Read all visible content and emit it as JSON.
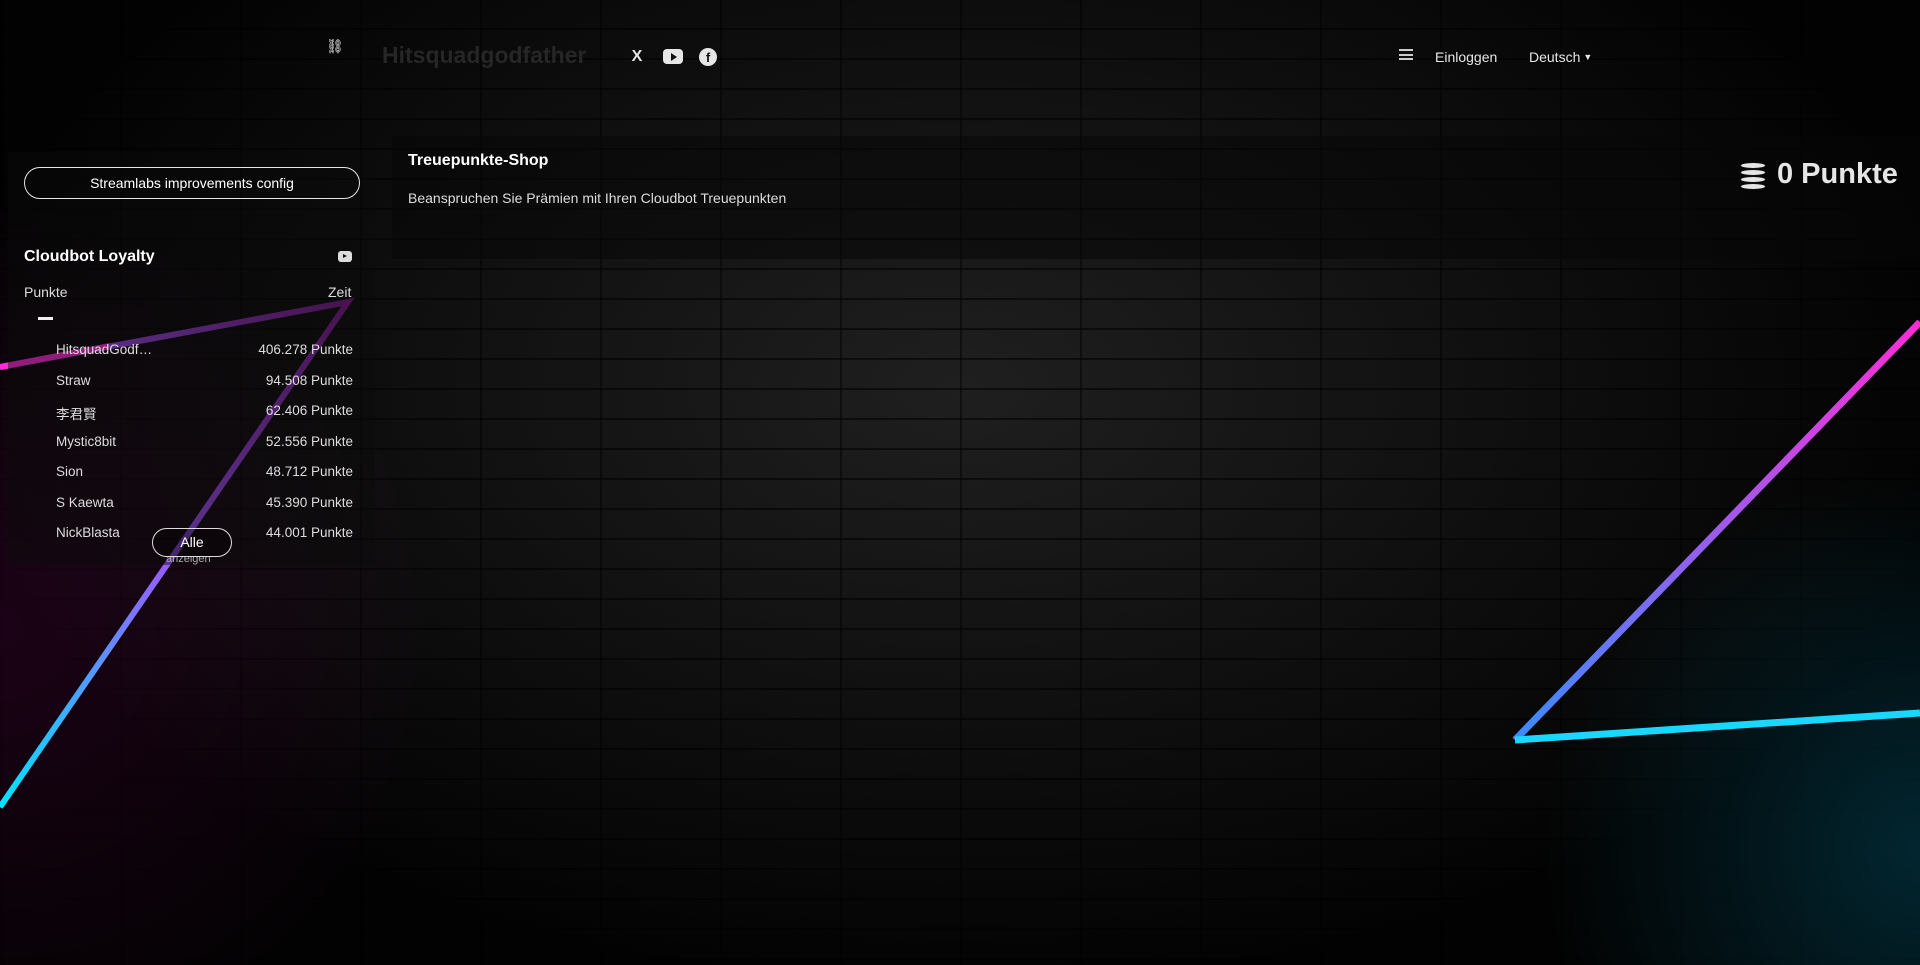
{
  "header": {
    "brand": "Hitsquadgodfather",
    "social": [
      {
        "name": "x-icon",
        "glyph": "X"
      },
      {
        "name": "youtube-icon",
        "glyph": ""
      },
      {
        "name": "facebook-icon",
        "glyph": "f"
      }
    ],
    "login_label": "Einloggen",
    "language_label": "Deutsch"
  },
  "sidebar": {
    "config_button_label": "Streamlabs improvements config",
    "loyalty_title": "Cloudbot Loyalty",
    "tabs": {
      "points": "Punkte",
      "time": "Zeit"
    },
    "ranking": [
      {
        "name": "HitsquadGodfather",
        "value": "406.278 Punkte"
      },
      {
        "name": "Straw",
        "value": "94.508 Punkte"
      },
      {
        "name": "李君賢",
        "value": "62.406 Punkte"
      },
      {
        "name": "Mystic8bit",
        "value": "52.556 Punkte"
      },
      {
        "name": "Sion",
        "value": "48.712 Punkte"
      },
      {
        "name": "S Kaewta",
        "value": "45.390 Punkte"
      },
      {
        "name": "NickBlasta",
        "value": "44.001 Punkte"
      }
    ],
    "show_all_label": "Alle",
    "show_all_label_2": "anzeigen"
  },
  "shop": {
    "title": "Treuepunkte-Shop",
    "subtitle": "Beanspruchen Sie Prämien mit Ihren Cloudbot Treuepunkten",
    "points_label": "0 Punkte"
  },
  "colors": {
    "neon_pink": "#ff2bd6",
    "neon_cyan": "#00e5ff",
    "neon_purple": "#7a1a86"
  }
}
